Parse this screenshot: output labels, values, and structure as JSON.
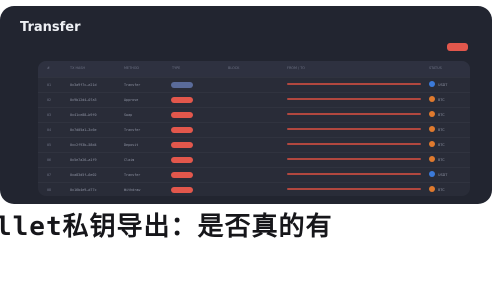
{
  "app": {
    "title": "Transfer"
  },
  "colors": {
    "panel_bg": "#222530",
    "accent_red": "#e2574c",
    "pill_blue": "#5a6b9a",
    "status_orange": "#e07a2e",
    "status_blue": "#3b7ad9"
  },
  "table": {
    "columns": [
      "#",
      "TX HASH",
      "METHOD",
      "TYPE",
      "BLOCK",
      "FROM / TO",
      "STATUS"
    ],
    "rows": [
      {
        "index": "01",
        "hash": "0x3a9f7c…e21d",
        "method": "Transfer",
        "type_color": "#5a6b9a",
        "status_color": "#3b7ad9",
        "status": "USDT"
      },
      {
        "index": "02",
        "hash": "0x9b12d4…07a3",
        "method": "Approve",
        "type_color": "#e2574c",
        "status_color": "#e07a2e",
        "status": "BTC"
      },
      {
        "index": "03",
        "hash": "0x41ce88…b9f0",
        "method": "Swap",
        "type_color": "#e2574c",
        "status_color": "#e07a2e",
        "status": "BTC"
      },
      {
        "index": "04",
        "hash": "0x7d05a1…3c6e",
        "method": "Transfer",
        "type_color": "#e2574c",
        "status_color": "#e07a2e",
        "status": "BTC"
      },
      {
        "index": "05",
        "hash": "0xc2f93b…58d4",
        "method": "Deposit",
        "type_color": "#e2574c",
        "status_color": "#e07a2e",
        "status": "BTC"
      },
      {
        "index": "06",
        "hash": "0x5e7a26…a1f9",
        "method": "Claim",
        "type_color": "#e2574c",
        "status_color": "#e07a2e",
        "status": "BTC"
      },
      {
        "index": "07",
        "hash": "0xa83d5f…6e02",
        "method": "Transfer",
        "type_color": "#e2574c",
        "status_color": "#3b7ad9",
        "status": "USDT"
      },
      {
        "index": "08",
        "hash": "0x16b4e9…d77c",
        "method": "Withdraw",
        "type_color": "#e2574c",
        "status_color": "#e07a2e",
        "status": "BTC"
      }
    ]
  },
  "headline": "llet私钥导出：是否真的有"
}
